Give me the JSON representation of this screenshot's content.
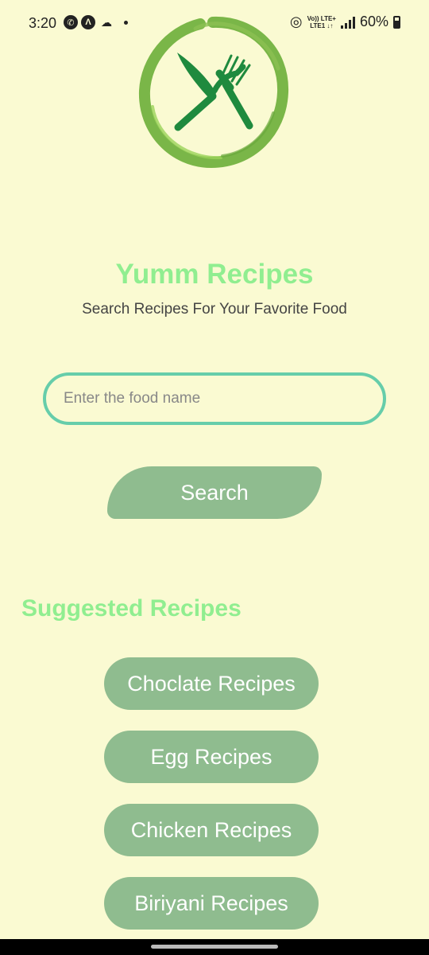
{
  "status_bar": {
    "time": "3:20",
    "battery": "60%",
    "network_top": "Vo)) LTE+",
    "network_bottom": "LTE1 ↓↑",
    "icons": [
      "whatsapp-icon",
      "a-icon",
      "games-icon",
      "hotspot-icon",
      "signal-icon",
      "battery-icon"
    ]
  },
  "app": {
    "title": "Yumm Recipes",
    "subtitle": "Search Recipes For Your Favorite Food"
  },
  "search": {
    "placeholder": "Enter the food name",
    "value": "",
    "button_label": "Search"
  },
  "suggested": {
    "heading": "Suggested Recipes",
    "items": [
      {
        "label": "Choclate Recipes"
      },
      {
        "label": "Egg Recipes"
      },
      {
        "label": "Chicken Recipes"
      },
      {
        "label": "Biriyani Recipes"
      }
    ]
  },
  "colors": {
    "background": "#fafad2",
    "accent_title": "#90ee90",
    "button": "#8fbc8f",
    "input_border": "#66cdaa",
    "logo_green": "#7ab648",
    "utensils": "#1f8a3e"
  }
}
